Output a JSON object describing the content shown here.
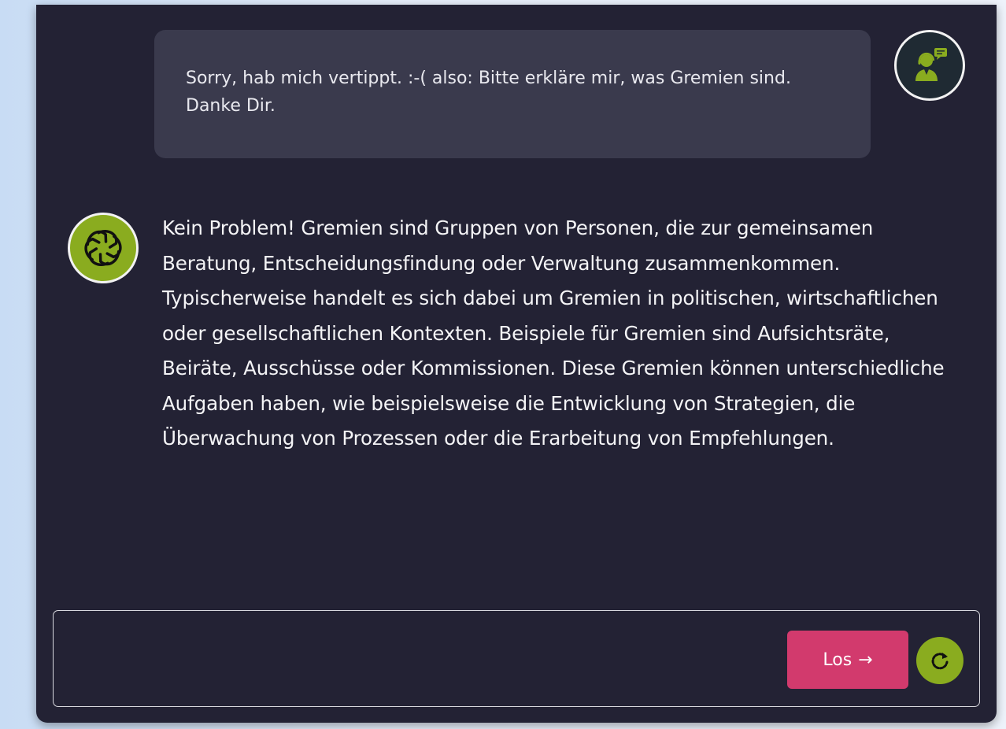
{
  "conversation": {
    "user_message": "Sorry, hab mich vertippt. :-( also: Bitte erkläre mir, was Gremien sind. Danke Dir.",
    "bot_message": "Kein Problem! Gremien sind Gruppen von Personen, die zur gemeinsamen Beratung, Entscheidungsfindung oder Verwaltung zusammenkommen. Typischerweise handelt es sich dabei um Gremien in politischen, wirtschaftlichen oder gesellschaftlichen Kontexten. Beispiele für Gremien sind Aufsichtsräte, Beiräte, Ausschüsse oder Kommissionen. Diese Gremien können unterschiedliche Aufgaben haben, wie beispielsweise die Entwicklung von Strategien, die Überwachung von Prozessen oder die Erarbeitung von Empfehlungen."
  },
  "input": {
    "value": "",
    "send_label": "Los",
    "send_arrow": "→"
  },
  "icons": {
    "user_avatar": "user-support-avatar-icon",
    "bot_avatar": "openai-logo-icon",
    "reset": "refresh-icon"
  },
  "colors": {
    "panel_bg": "#232234",
    "user_bubble_bg": "#3a3a4d",
    "accent_green": "#8aac1f",
    "send_button": "#d23a6d"
  }
}
